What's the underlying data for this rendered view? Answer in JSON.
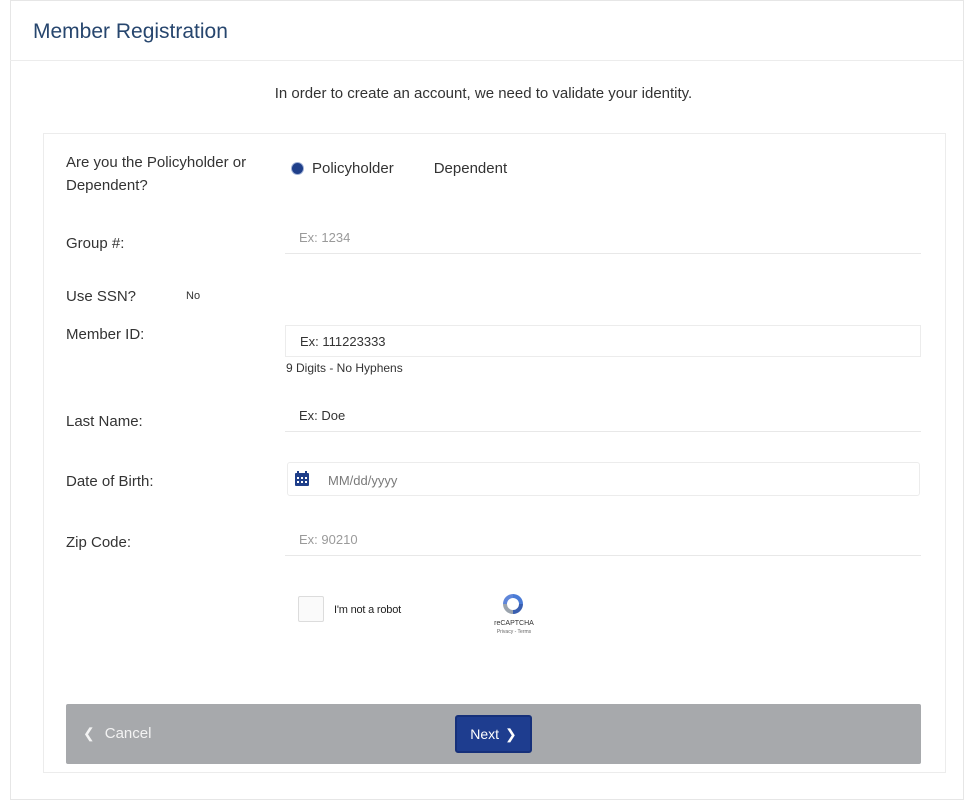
{
  "header": {
    "title": "Member Registration"
  },
  "intro": "In order to create an account, we need to validate your identity.",
  "form": {
    "role_question": "Are you the Policyholder or Dependent?",
    "role_options": [
      "Policyholder",
      "Dependent"
    ],
    "role_selected": "Policyholder",
    "group_label": "Group #:",
    "group_placeholder": "Ex: 1234",
    "ssn_label": "Use SSN?",
    "ssn_value": "No",
    "member_id_label": "Member ID:",
    "member_id_placeholder": "Ex: 111223333",
    "member_id_hint": "9 Digits - No Hyphens",
    "last_name_label": "Last Name:",
    "last_name_placeholder": "Ex: Doe",
    "dob_label": "Date of Birth:",
    "dob_placeholder": "MM/dd/yyyy",
    "zip_label": "Zip Code:",
    "zip_placeholder": "Ex: 90210"
  },
  "captcha": {
    "label": "I'm not a robot",
    "brand": "reCAPTCHA",
    "links": "Privacy - Terms"
  },
  "footer": {
    "cancel_label": "Cancel",
    "next_label": "Next"
  },
  "colors": {
    "title": "#27466e",
    "primary_button": "#1e3d8f",
    "footer_bar": "#a7a9ac",
    "radio_selected": "#1f3f8a"
  }
}
